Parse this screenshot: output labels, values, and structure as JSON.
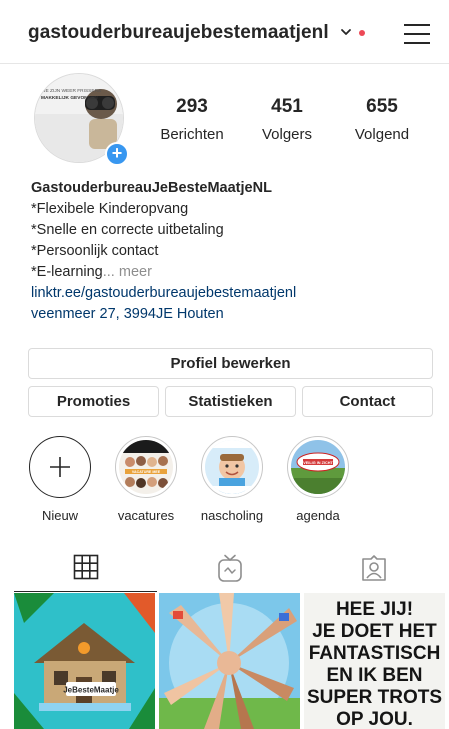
{
  "header": {
    "username": "gastouderbureaujebestemaatjenl",
    "icons": [
      "chevron-down-icon",
      "notification-dot",
      "hamburger-menu-icon"
    ]
  },
  "profile": {
    "avatar_text_line1": "WE ZIJN WEER FRISSERS",
    "avatar_text_line2": "MAKKELIJK GEVONDEN",
    "stats": [
      {
        "value": "293",
        "label": "Berichten"
      },
      {
        "value": "451",
        "label": "Volgers"
      },
      {
        "value": "655",
        "label": "Volgend"
      }
    ]
  },
  "bio": {
    "name": "GastouderbureauJeBesteMaatjeNL",
    "line1": "*Flexibele Kinderopvang",
    "line2": "*Snelle en correcte uitbetaling",
    "line3": "*Persoonlijk contact",
    "line4": "*E-learning",
    "more": "... meer",
    "link": "linktr.ee/gastouderbureaujebestemaatjenl",
    "address": "veenmeer 27, 3994JE Houten"
  },
  "actions": {
    "edit_profile": "Profiel bewerken",
    "promotions": "Promoties",
    "statistics": "Statistieken",
    "contact": "Contact"
  },
  "highlights": [
    {
      "label": "Nieuw"
    },
    {
      "label": "vacatures",
      "image_text": "VACATURE MEE"
    },
    {
      "label": "nascholing"
    },
    {
      "label": "agenda",
      "image_text": "VEILIG IN ZICHT"
    }
  ],
  "tabs": [
    "grid-icon",
    "igtv-icon",
    "tagged-icon"
  ],
  "posts": [
    {
      "caption": "JeBesteMaatje"
    },
    {
      "caption": ""
    },
    {
      "caption": "HEE JIJ! JE DOET HET FANTASTISCH EN IK BEN SUPER TROTS OP JOU.",
      "lines": [
        "HEE JIJ!",
        "JE DOET HET",
        "FANTASTISCH",
        "EN IK BEN",
        "SUPER TROTS",
        "OP JOU."
      ]
    }
  ]
}
